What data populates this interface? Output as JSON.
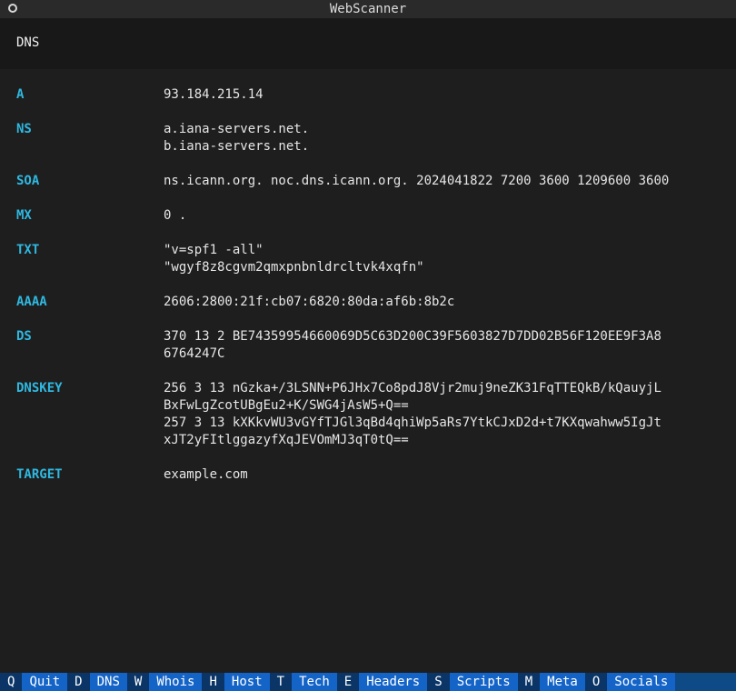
{
  "window": {
    "title": "WebScanner"
  },
  "header": {
    "section_title": "DNS"
  },
  "records": [
    {
      "type": "A",
      "values": [
        "93.184.215.14"
      ]
    },
    {
      "type": "NS",
      "values": [
        "a.iana-servers.net.",
        "b.iana-servers.net."
      ]
    },
    {
      "type": "SOA",
      "values": [
        "ns.icann.org. noc.dns.icann.org. 2024041822 7200 3600 1209600 3600"
      ]
    },
    {
      "type": "MX",
      "values": [
        "0 ."
      ]
    },
    {
      "type": "TXT",
      "values": [
        "\"v=spf1 -all\"",
        "\"wgyf8z8cgvm2qmxpnbnldrcltvk4xqfn\""
      ]
    },
    {
      "type": "AAAA",
      "values": [
        "2606:2800:21f:cb07:6820:80da:af6b:8b2c"
      ]
    },
    {
      "type": "DS",
      "values": [
        "370 13 2 BE74359954660069D5C63D200C39F5603827D7DD02B56F120EE9F3A8",
        "6764247C"
      ]
    },
    {
      "type": "DNSKEY",
      "values": [
        "256 3 13 nGzka+/3LSNN+P6JHx7Co8pdJ8Vjr2muj9neZK31FqTTEQkB/kQauyjL",
        "BxFwLgZcotUBgEu2+K/SWG4jAsW5+Q==",
        "257 3 13 kXKkvWU3vGYfTJGl3qBd4qhiWp5aRs7YtkCJxD2d+t7KXqwahww5IgJt",
        "xJT2yFItlggazyfXqJEVOmMJ3qT0tQ=="
      ]
    },
    {
      "type": "TARGET",
      "values": [
        "example.com"
      ]
    }
  ],
  "footer": {
    "items": [
      {
        "key": "Q",
        "label": "Quit"
      },
      {
        "key": "D",
        "label": "DNS"
      },
      {
        "key": "W",
        "label": "Whois"
      },
      {
        "key": "H",
        "label": "Host"
      },
      {
        "key": "T",
        "label": "Tech"
      },
      {
        "key": "E",
        "label": "Headers"
      },
      {
        "key": "S",
        "label": "Scripts"
      },
      {
        "key": "M",
        "label": "Meta"
      },
      {
        "key": "O",
        "label": "Socials"
      }
    ]
  }
}
